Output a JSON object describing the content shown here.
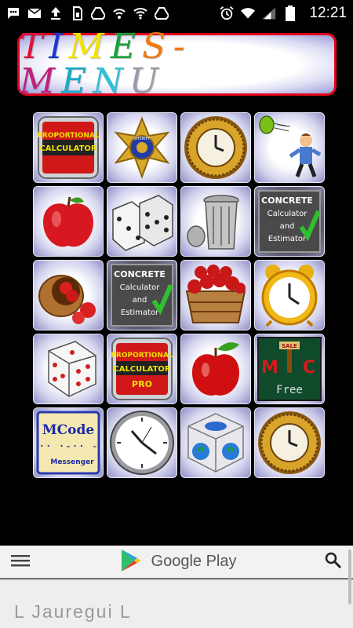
{
  "status_bar": {
    "time": "12:21",
    "left_icons": [
      "chat-icon",
      "mail-icon",
      "upload-icon",
      "sim-icon",
      "drive-icon",
      "wifi-call-icon",
      "wifi-icon",
      "drive-icon"
    ],
    "right_icons": [
      "alarm-icon",
      "wifi-icon",
      "signal-icon",
      "battery-icon"
    ]
  },
  "title": {
    "letters": [
      "T",
      "I",
      "M",
      "E",
      "S",
      "-",
      "M",
      "E",
      "N",
      "U"
    ],
    "colors": [
      "#e0103a",
      "#1b35d6",
      "#f2e400",
      "#18a03a",
      "#f07a10",
      "#f07a10",
      "#c0207a",
      "#1aa8c8",
      "#30c0d8",
      "#9a9aa8"
    ],
    "border_color": "#e0001a"
  },
  "apps": [
    {
      "name": "proportional-calculator",
      "label": "PROPORTIONAL CALCULATOR"
    },
    {
      "name": "sheriff-badge",
      "label": "SHERIFF"
    },
    {
      "name": "gold-clock",
      "label": ""
    },
    {
      "name": "water-balloon-man",
      "label": ""
    },
    {
      "name": "red-apple",
      "label": ""
    },
    {
      "name": "dice",
      "label": ""
    },
    {
      "name": "trash-can",
      "label": ""
    },
    {
      "name": "concrete-calculator",
      "label": "CONCRETE Calculator and Estimator"
    },
    {
      "name": "apple-basket-tipped",
      "label": ""
    },
    {
      "name": "concrete-calculator-2",
      "label": "CONCRETE Calculator and Estimator"
    },
    {
      "name": "apple-basket",
      "label": ""
    },
    {
      "name": "alarm-clock",
      "label": ""
    },
    {
      "name": "single-die",
      "label": ""
    },
    {
      "name": "proportional-calculator-pro",
      "label": "PROPORTIONAL CALCULATOR PRO"
    },
    {
      "name": "apple-leaf",
      "label": ""
    },
    {
      "name": "mc-free",
      "label": "MC Free"
    },
    {
      "name": "mcode-messenger",
      "label": "MCode Messenger"
    },
    {
      "name": "wall-clock",
      "label": ""
    },
    {
      "name": "recycle-cube",
      "label": ""
    },
    {
      "name": "gold-clock-2",
      "label": ""
    }
  ],
  "play_bar": {
    "label": "Google Play",
    "menu_icon": "hamburger-icon",
    "search_icon": "search-icon"
  },
  "developer": "L Jauregui L"
}
